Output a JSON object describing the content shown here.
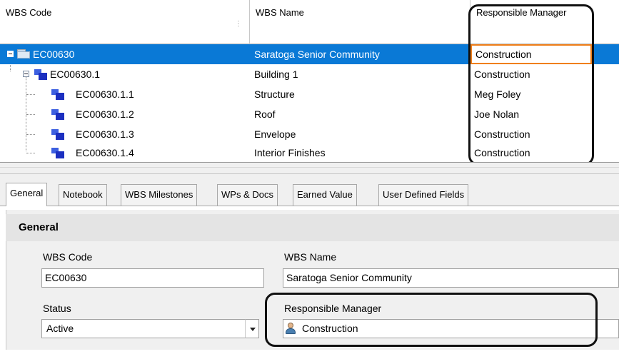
{
  "grid": {
    "columns": {
      "code": "WBS Code",
      "name": "WBS Name",
      "manager": "Responsible Manager"
    },
    "rows": [
      {
        "code": "EC00630",
        "name": "Saratoga Senior Community",
        "manager": "Construction"
      },
      {
        "code": "EC00630.1",
        "name": "Building 1",
        "manager": "Construction"
      },
      {
        "code": "EC00630.1.1",
        "name": "Structure",
        "manager": "Meg Foley"
      },
      {
        "code": "EC00630.1.2",
        "name": "Roof",
        "manager": "Joe Nolan"
      },
      {
        "code": "EC00630.1.3",
        "name": "Envelope",
        "manager": "Construction"
      },
      {
        "code": "EC00630.1.4",
        "name": "Interior Finishes",
        "manager": "Construction"
      }
    ]
  },
  "tabs": [
    "General",
    "Notebook",
    "WBS Milestones",
    "WPs & Docs",
    "Earned Value",
    "User Defined Fields"
  ],
  "general": {
    "title": "General",
    "wbs_code_label": "WBS Code",
    "wbs_code_value": "EC00630",
    "wbs_name_label": "WBS Name",
    "wbs_name_value": "Saratoga Senior Community",
    "status_label": "Status",
    "status_value": "Active",
    "manager_label": "Responsible Manager",
    "manager_value": "Construction"
  },
  "colors": {
    "selection": "#0a79d6",
    "focus_border": "#f07f1a"
  },
  "icons": [
    "folder-icon",
    "wbs-icon",
    "person-icon",
    "chevron-down-icon",
    "collapse-icon",
    "column-sort-icon"
  ]
}
